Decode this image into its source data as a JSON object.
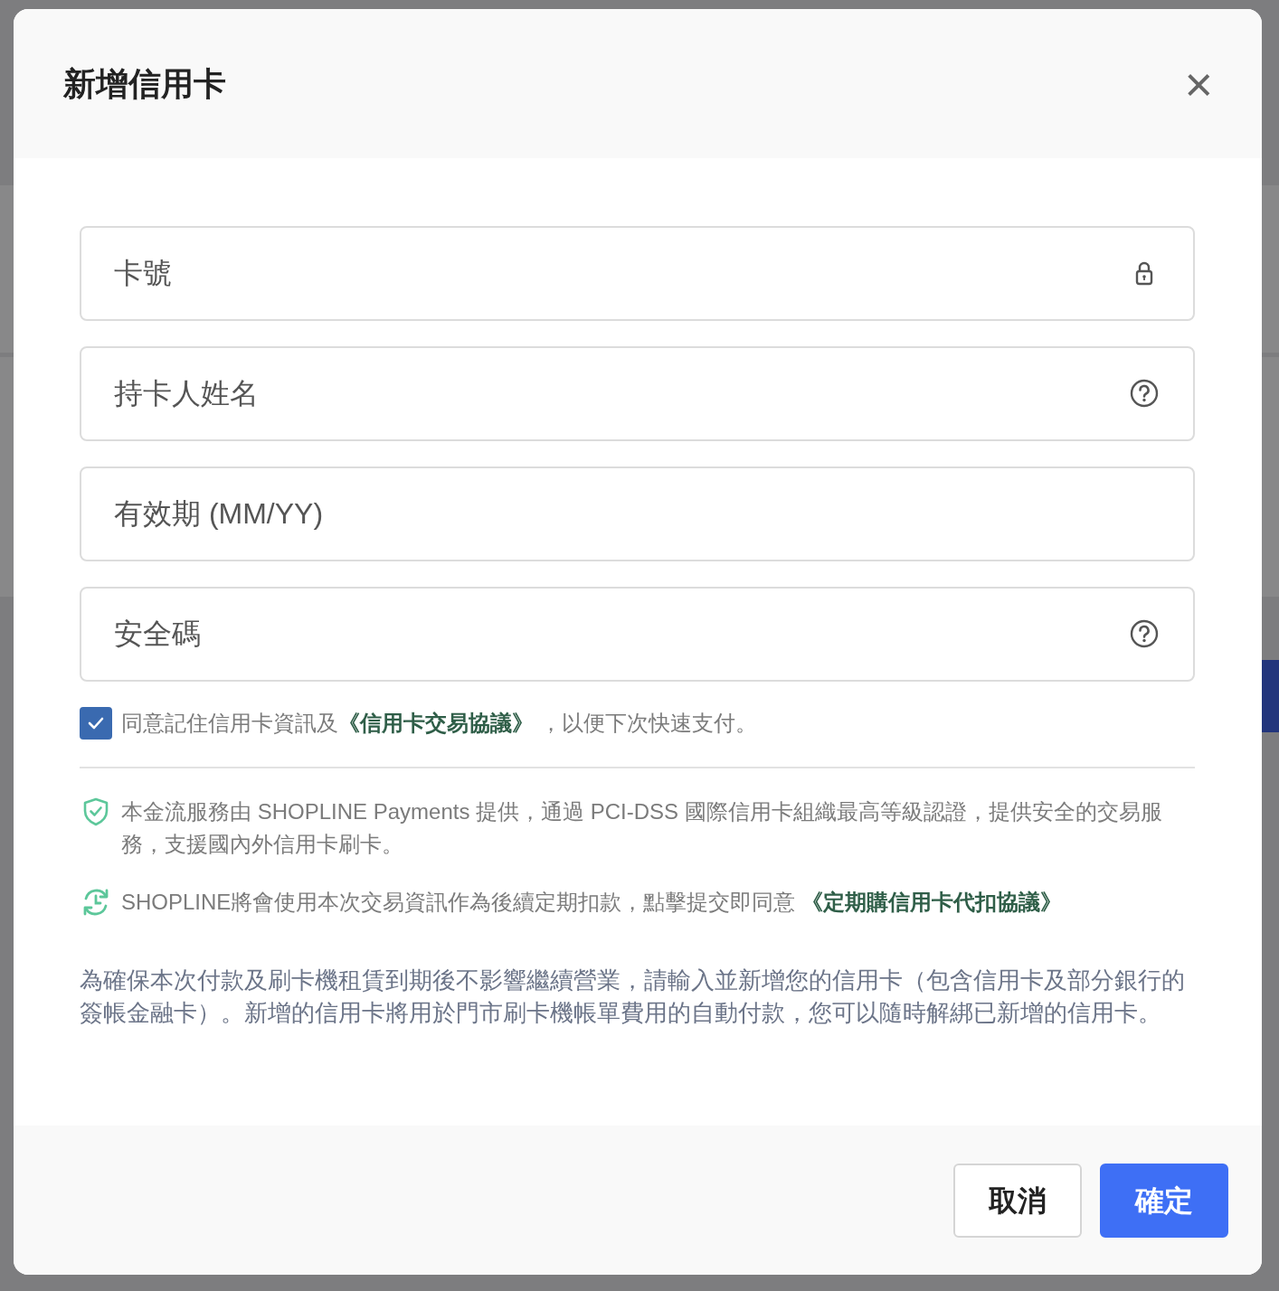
{
  "dialog": {
    "title": "新增信用卡",
    "close": "×"
  },
  "fields": [
    {
      "placeholder": "卡號",
      "kind": "lock"
    },
    {
      "placeholder": "持卡人姓名",
      "kind": "help"
    },
    {
      "placeholder": "有效期 (MM/YY)",
      "kind": "plain"
    },
    {
      "placeholder": "安全碼",
      "kind": "help"
    }
  ],
  "consent": {
    "checked": true,
    "before": "同意記住信用卡資訊及",
    "link": "《信用卡交易協議》",
    "after": "，以便下次快速支付。"
  },
  "notices": [
    {
      "kind": "shield",
      "text": "本金流服務由 SHOPLINE Payments 提供，通過 PCI-DSS 國際信用卡組織最高等級認證，提供安全的交易服務，支援國內外信用卡刷卡。"
    },
    {
      "kind": "recurring",
      "text": "SHOPLINE將會使用本次交易資訊作為後續定期扣款，點擊提交即同意 ",
      "link": "《定期購信用卡代扣協議》"
    }
  ],
  "description": "為確保本次付款及刷卡機租賃到期後不影響繼續營業，請輸入並新增您的信用卡（包含信用卡及部分銀行的簽帳金融卡）。新增的信用卡將用於門市刷卡機帳單費用的自動付款，您可以隨時解綁已新增的信用卡。",
  "buttons": [
    {
      "label": "取消",
      "kind": "secondary"
    },
    {
      "label": "確定",
      "kind": "primary"
    }
  ]
}
